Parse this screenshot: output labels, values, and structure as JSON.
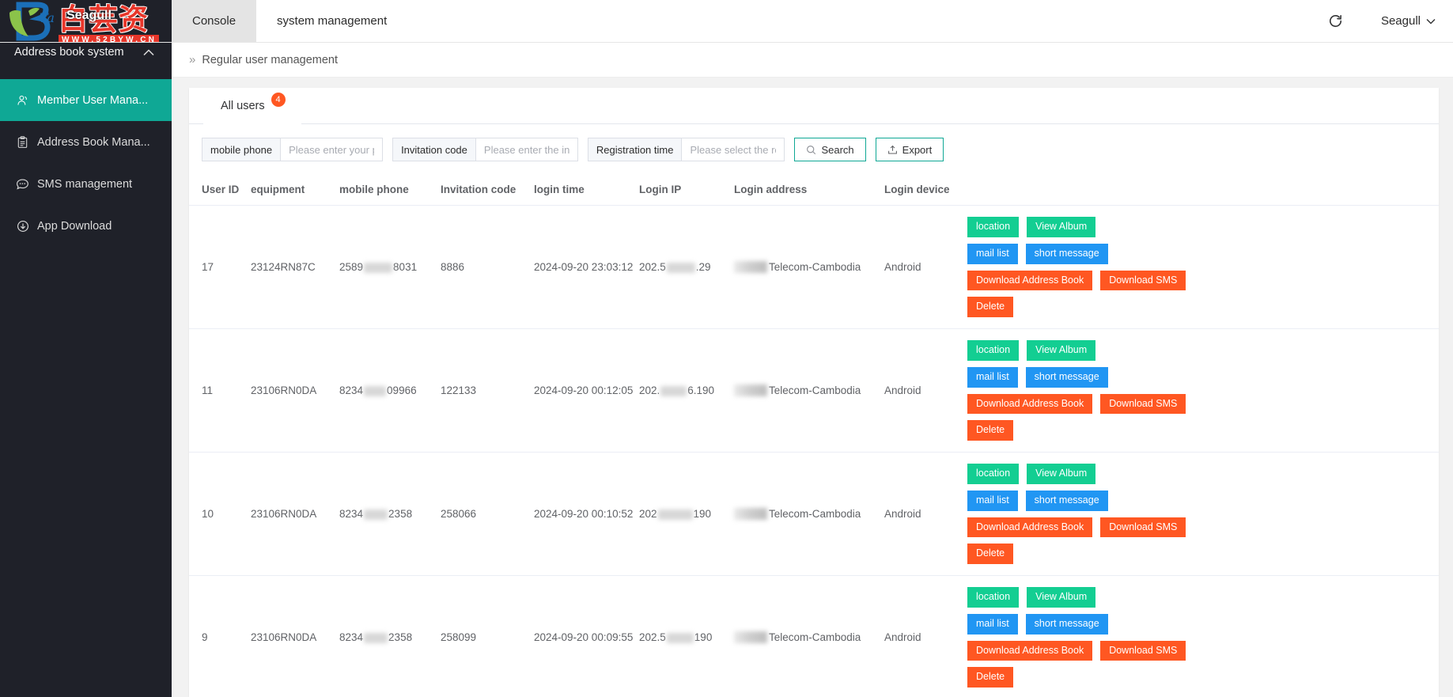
{
  "brand": {
    "name": "Seagull",
    "watermark_text": "白芸资源网",
    "watermark_sub": "WWW.52BYW.CN",
    "sidebar_title": "Address book system",
    "collapse_icon": "chevron-up-icon"
  },
  "topbar": {
    "tabs": [
      {
        "label": "Console",
        "active": true
      },
      {
        "label": "system management",
        "active": false
      }
    ],
    "refresh_icon": "refresh-icon",
    "user_name": "Seagull",
    "user_caret_icon": "chevron-down-icon"
  },
  "sidebar": {
    "items": [
      {
        "label": "Member User Mana...",
        "icon": "user-group-icon",
        "active": true
      },
      {
        "label": "Address Book Mana...",
        "icon": "clipboard-icon",
        "active": false
      },
      {
        "label": "SMS management",
        "icon": "chat-bubble-icon",
        "active": false
      },
      {
        "label": "App Download",
        "icon": "download-circle-icon",
        "active": false
      }
    ]
  },
  "breadcrumb": {
    "arrow": "»",
    "current": "Regular user management"
  },
  "panel": {
    "tabs": [
      {
        "label": "All users",
        "badge": "4",
        "active": true
      }
    ]
  },
  "filters": {
    "phone": {
      "label": "mobile phone",
      "placeholder": "Please enter your phone",
      "value": ""
    },
    "invite": {
      "label": "Invitation code",
      "placeholder": "Please enter the invitatio",
      "value": ""
    },
    "regtime": {
      "label": "Registration time",
      "placeholder": "Please select the registr",
      "value": ""
    },
    "search_button": {
      "label": "Search",
      "icon": "search-icon"
    },
    "export_button": {
      "label": "Export",
      "icon": "export-icon"
    }
  },
  "table": {
    "columns": [
      "User ID",
      "equipment",
      "mobile phone",
      "Invitation code",
      "login time",
      "Login IP",
      "Login address",
      "Login device",
      ""
    ],
    "action_labels": {
      "location": "location",
      "view_album": "View Album",
      "mail_list": "mail list",
      "short_message": "short message",
      "download_address_book": "Download Address Book",
      "download_sms": "Download SMS",
      "delete": "Delete"
    },
    "rows": [
      {
        "user_id": "17",
        "equipment": "23124RN87C",
        "phone_prefix": "2589",
        "phone_suffix": "8031",
        "phone_blur_w": 36,
        "invitation_code": "8886",
        "login_time": "2024-09-20 23:03:12",
        "ip_prefix": "202.5",
        "ip_suffix": ".29",
        "ip_blur_w": 36,
        "login_address": "Telecom-Cambodia",
        "login_device": "Android"
      },
      {
        "user_id": "11",
        "equipment": "23106RN0DA",
        "phone_prefix": "8234",
        "phone_suffix": "09966",
        "phone_blur_w": 28,
        "invitation_code": "122133",
        "login_time": "2024-09-20 00:12:05",
        "ip_prefix": "202.",
        "ip_suffix": "6.190",
        "ip_blur_w": 33,
        "login_address": "Telecom-Cambodia",
        "login_device": "Android"
      },
      {
        "user_id": "10",
        "equipment": "23106RN0DA",
        "phone_prefix": "8234",
        "phone_suffix": "2358",
        "phone_blur_w": 30,
        "invitation_code": "258066",
        "login_time": "2024-09-20 00:10:52",
        "ip_prefix": "202",
        "ip_suffix": "190",
        "ip_blur_w": 44,
        "login_address": "Telecom-Cambodia",
        "login_device": "Android"
      },
      {
        "user_id": "9",
        "equipment": "23106RN0DA",
        "phone_prefix": "8234",
        "phone_suffix": "2358",
        "phone_blur_w": 30,
        "invitation_code": "258099",
        "login_time": "2024-09-20 00:09:55",
        "ip_prefix": "202.5",
        "ip_suffix": "190",
        "ip_blur_w": 34,
        "login_address": "Telecom-Cambodia",
        "login_device": "Android"
      }
    ]
  },
  "colors": {
    "sidebar_bg": "#1f2129",
    "accent_teal": "#0fa895",
    "button_teal": "#13ce92",
    "button_blue": "#2196f3",
    "button_orange": "#ff5722",
    "badge_orange": "#ff5722"
  }
}
